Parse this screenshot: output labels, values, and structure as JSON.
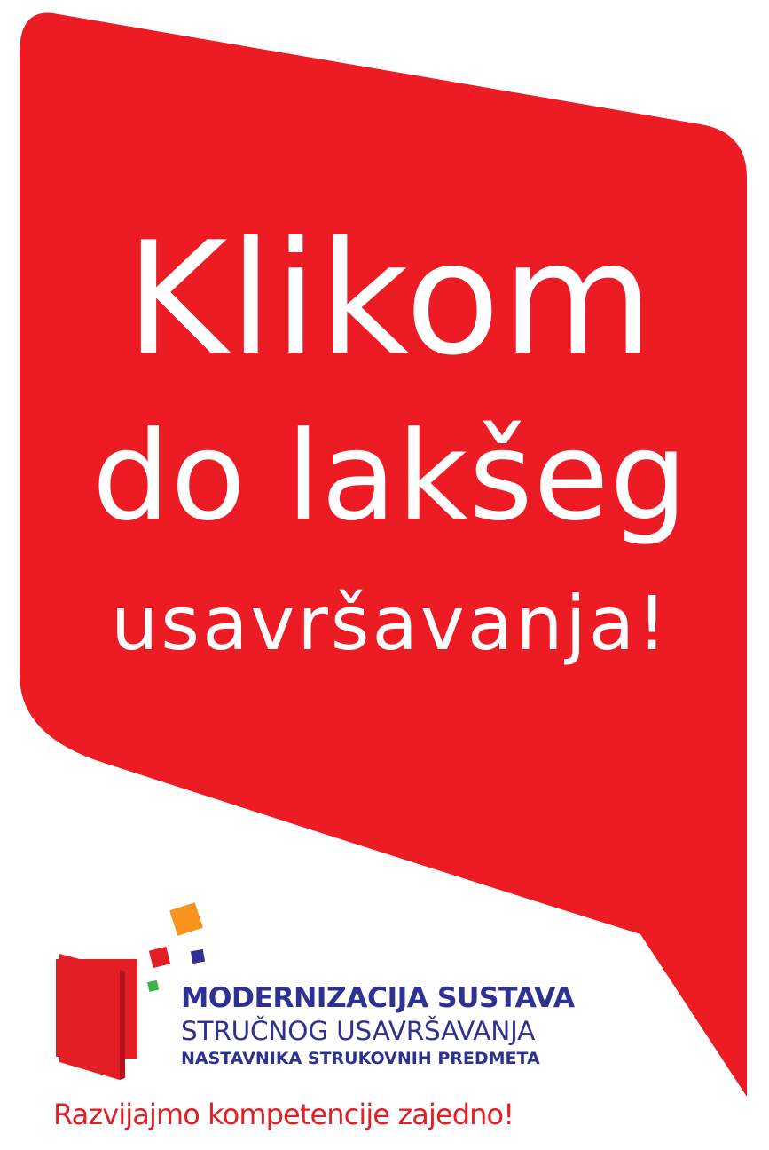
{
  "banner": {
    "color": "#ED1C24",
    "headline_lines": [
      "Klikom",
      "do lakšeg",
      "usavršavanja!"
    ]
  },
  "logo": {
    "org_name_lines": [
      "MODERNIZACIJA SUSTAVA",
      "STRUČNOG USAVRŠAVANJA",
      "NASTAVNIKA STRUKOVNIH PREDMETA"
    ],
    "org_name_color": "#2E3192",
    "tagline": "Razvijajmo kompetencije zajedno!",
    "tagline_color": "#E31E24",
    "icon": "open-door-icon",
    "square_colors": [
      "#F7941D",
      "#E31E24",
      "#2E3192",
      "#39B54A"
    ]
  }
}
